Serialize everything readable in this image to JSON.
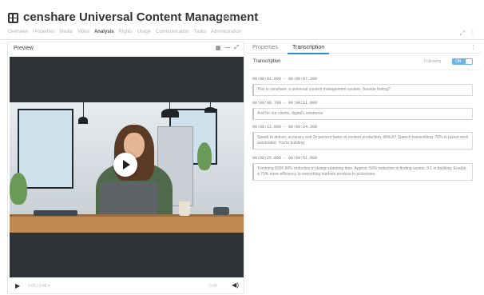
{
  "app": {
    "title": "censhare Universal Content Management",
    "subtitle": "Video"
  },
  "tabs": [
    {
      "label": "Overview",
      "active": false
    },
    {
      "label": "Properties",
      "active": false
    },
    {
      "label": "Media",
      "active": false
    },
    {
      "label": "Video",
      "active": false
    },
    {
      "label": "Analysis",
      "active": true
    },
    {
      "label": "Rights",
      "active": false
    },
    {
      "label": "Usage",
      "active": false
    },
    {
      "label": "Communication",
      "active": false
    },
    {
      "label": "Tasks",
      "active": false
    },
    {
      "label": "Administration",
      "active": false
    }
  ],
  "header_icons": {
    "expand": "⤢",
    "more": "⋮"
  },
  "preview": {
    "title": "Preview",
    "tools": {
      "grid": "▦",
      "minus": "—",
      "expand": "⤢"
    },
    "controls": {
      "play": "▶",
      "time": "0:00 / 0:48 ▾",
      "duration": "0:48",
      "volume": "◀)"
    }
  },
  "right_panel": {
    "tabs": {
      "properties": "Properties",
      "transcription": "Transcription"
    },
    "menu": "⋮",
    "section_title": "Transcription",
    "following_label": "Following",
    "toggle_label": "ON",
    "segments": [
      {
        "time": "00:00:01.000 - 00:00:07.200",
        "text": "This is censhare, a universal content management system. Sounds boring?"
      },
      {
        "time": "00:00:08.700 - 00:00:11.900",
        "text": "And for our clients, digital's existence."
      },
      {
        "time": "00:00:12.800 - 00:00:24.300",
        "text": "Speed to deliver, accuracy and 3x percent faster in content production. Which? Speech transcribing. 70% in layout work automated. You're building."
      },
      {
        "time": "00:00:25.800 - 00:00:51.900",
        "text": "Trimming 8000 98% reduction in design planning time. Approx. 50% reduction in finding assets. 3:1 in building. Enable a 70% more efficiency to everything markets produce in processes."
      }
    ]
  }
}
